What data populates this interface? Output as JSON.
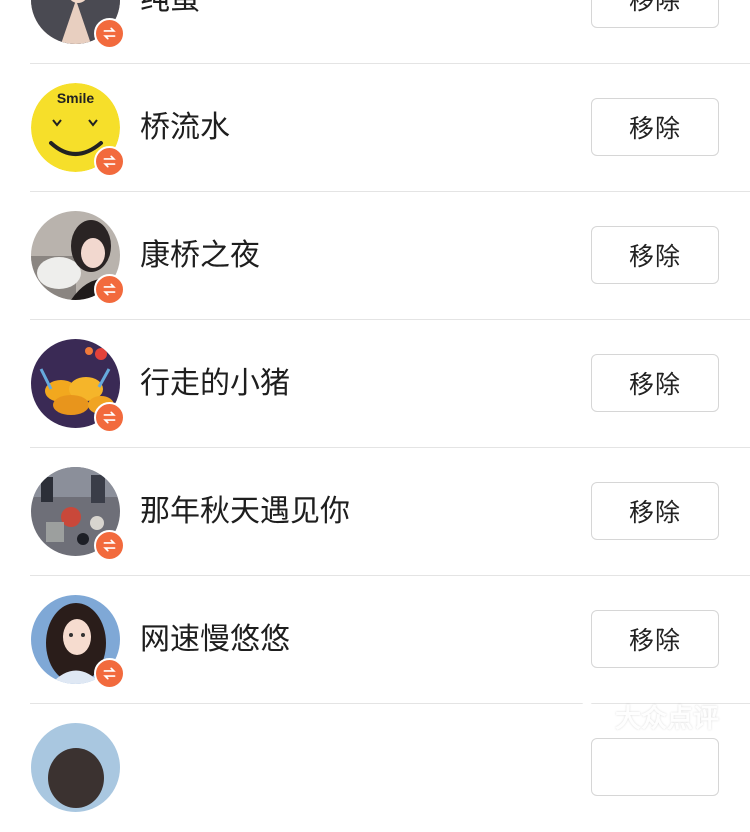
{
  "rows": [
    {
      "name": "纯蛋",
      "remove_label": "移除",
      "avatar_icon": "cartoon-girl-photo"
    },
    {
      "name": "桥流水",
      "remove_label": "移除",
      "avatar_icon": "smile-face",
      "avatar_text": "Smile"
    },
    {
      "name": "康桥之夜",
      "remove_label": "移除",
      "avatar_icon": "girl-with-cat-photo"
    },
    {
      "name": "行走的小猪",
      "remove_label": "移除",
      "avatar_icon": "orange-flowers-photo"
    },
    {
      "name": "那年秋天遇见你",
      "remove_label": "移除",
      "avatar_icon": "game-scene-photo"
    },
    {
      "name": "网速慢悠悠",
      "remove_label": "移除",
      "avatar_icon": "anime-girl-photo"
    },
    {
      "name": "",
      "remove_label": "",
      "avatar_icon": "partial-avatar"
    }
  ],
  "badge_icon": "swap-arrows-icon",
  "watermark": {
    "text": "大众点评",
    "icon": "dianping-logo-icon"
  },
  "colors": {
    "badge": "#f26a3d",
    "divider": "#e4e4e4",
    "button_border": "#d6d6d6",
    "smile_face": "#f6df2a"
  }
}
